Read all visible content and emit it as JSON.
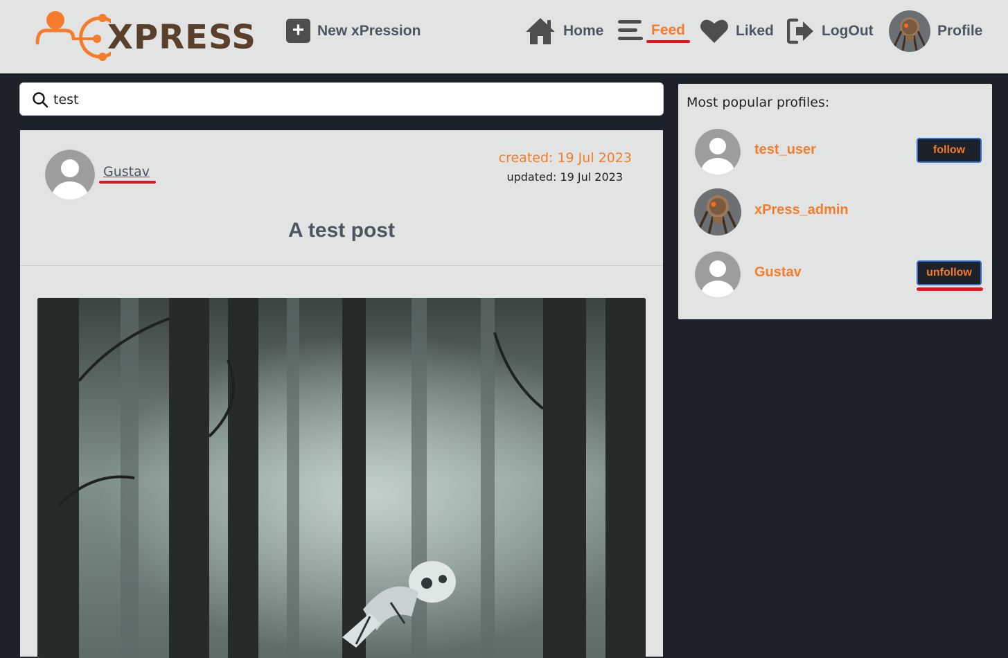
{
  "brand": {
    "logo_text": "XPRESS",
    "accent_color": "#f47c2c",
    "brown_color": "#5a3f2a"
  },
  "nav": {
    "new_label": "New xPression",
    "items": [
      {
        "label": "Home",
        "icon": "home-icon"
      },
      {
        "label": "Feed",
        "icon": "menu-icon",
        "active": true
      },
      {
        "label": "Liked",
        "icon": "heart-icon"
      },
      {
        "label": "LogOut",
        "icon": "logout-icon"
      },
      {
        "label": "Profile",
        "icon": "robot-avatar"
      }
    ]
  },
  "search": {
    "value": "test"
  },
  "post": {
    "author": "Gustav",
    "created": "created: 19 Jul 2023",
    "updated": "updated: 19 Jul 2023",
    "title": "A test post",
    "image_icon": "robot-in-forest-image"
  },
  "sidebar": {
    "title": "Most popular profiles:",
    "profiles": [
      {
        "name": "test_user",
        "button": "follow",
        "avatar": "default-user-avatar"
      },
      {
        "name": "xPress_admin",
        "button": "",
        "avatar": "robot-avatar"
      },
      {
        "name": "Gustav",
        "button": "unfollow",
        "avatar": "default-user-avatar"
      }
    ]
  }
}
